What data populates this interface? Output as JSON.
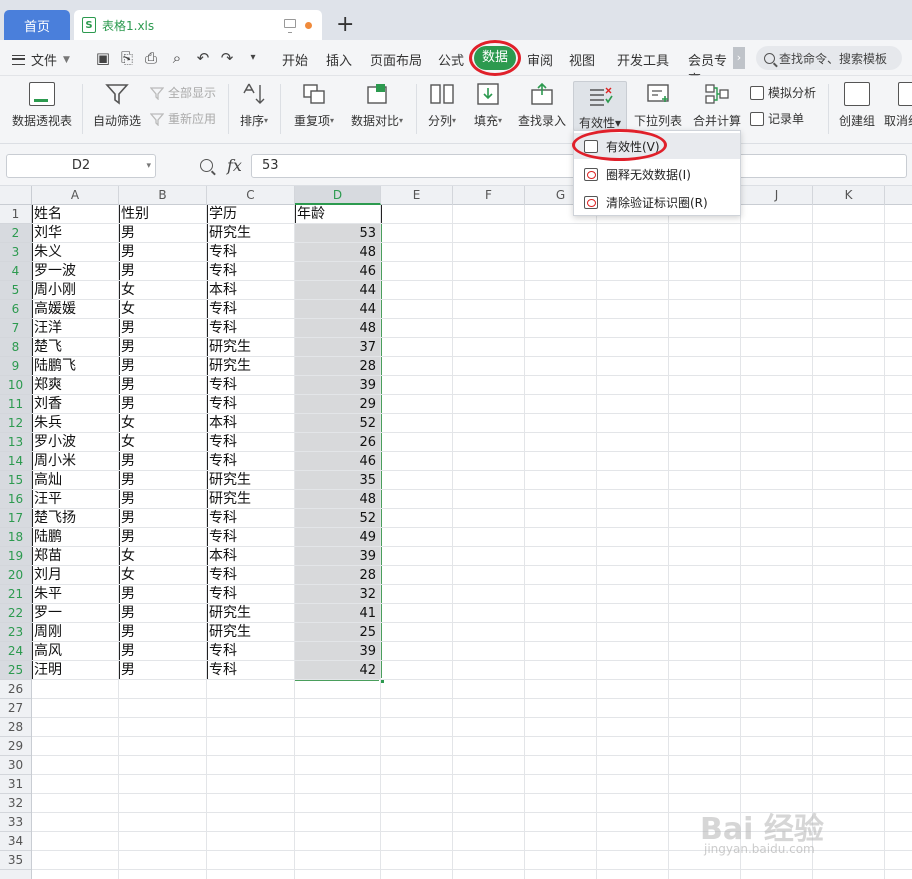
{
  "tabs": {
    "home": "首页",
    "file": "表格1.xls",
    "new_tab": "+"
  },
  "menu": {
    "file": "文件",
    "items": [
      "开始",
      "插入",
      "页面布局",
      "公式",
      "数据",
      "审阅",
      "视图",
      "开发工具",
      "会员专享"
    ],
    "active": "数据",
    "search_placeholder": "查找命令、搜索模板"
  },
  "ribbon": {
    "pivot": "数据透视表",
    "autofilter": "自动筛选",
    "show_all": "全部显示",
    "reapply": "重新应用",
    "sort": "排序",
    "duplicates": "重复项",
    "compare": "数据对比",
    "split": "分列",
    "fill": "填充",
    "find_entry": "查找录入",
    "validity": "有效性",
    "dropdown_list": "下拉列表",
    "consolidate": "合并计算",
    "whatif": "模拟分析",
    "record_sheet": "记录单",
    "create_group": "创建组",
    "ungroup": "取消组"
  },
  "dropdown": {
    "items": [
      "有效性(V)",
      "圈释无效数据(I)",
      "清除验证标识圈(R)"
    ]
  },
  "formula_bar": {
    "name_box": "D2",
    "fx": "fx",
    "value": "53"
  },
  "sheet": {
    "columns": [
      "A",
      "B",
      "C",
      "D",
      "E",
      "F",
      "G",
      "H",
      "I",
      "J",
      "K"
    ],
    "rows_visible": 35,
    "selected_column": "D",
    "header": [
      "姓名",
      "性别",
      "学历",
      "年龄"
    ],
    "rows": [
      [
        "刘华",
        "男",
        "研究生",
        "53"
      ],
      [
        "朱义",
        "男",
        "专科",
        "48"
      ],
      [
        "罗一波",
        "男",
        "专科",
        "46"
      ],
      [
        "周小刚",
        "女",
        "本科",
        "44"
      ],
      [
        "高媛媛",
        "女",
        "专科",
        "44"
      ],
      [
        "汪洋",
        "男",
        "专科",
        "48"
      ],
      [
        "楚飞",
        "男",
        "研究生",
        "37"
      ],
      [
        "陆鹏飞",
        "男",
        "研究生",
        "28"
      ],
      [
        "郑爽",
        "男",
        "专科",
        "39"
      ],
      [
        "刘香",
        "男",
        "专科",
        "29"
      ],
      [
        "朱兵",
        "女",
        "本科",
        "52"
      ],
      [
        "罗小波",
        "女",
        "专科",
        "26"
      ],
      [
        "周小米",
        "男",
        "专科",
        "46"
      ],
      [
        "高灿",
        "男",
        "研究生",
        "35"
      ],
      [
        "汪平",
        "男",
        "研究生",
        "48"
      ],
      [
        "楚飞扬",
        "男",
        "专科",
        "52"
      ],
      [
        "陆鹏",
        "男",
        "专科",
        "49"
      ],
      [
        "郑苗",
        "女",
        "本科",
        "39"
      ],
      [
        "刘月",
        "女",
        "专科",
        "28"
      ],
      [
        "朱平",
        "男",
        "专科",
        "32"
      ],
      [
        "罗一",
        "男",
        "研究生",
        "41"
      ],
      [
        "周刚",
        "男",
        "研究生",
        "25"
      ],
      [
        "高风",
        "男",
        "专科",
        "39"
      ],
      [
        "汪明",
        "男",
        "专科",
        "42"
      ]
    ]
  },
  "watermark": {
    "logo": "Bai 经验",
    "url": "jingyan.baidu.com"
  },
  "colors": {
    "accent_green": "#2c9a4f",
    "highlight_red": "#e0202a",
    "home_tab_blue": "#4a7fdb"
  }
}
